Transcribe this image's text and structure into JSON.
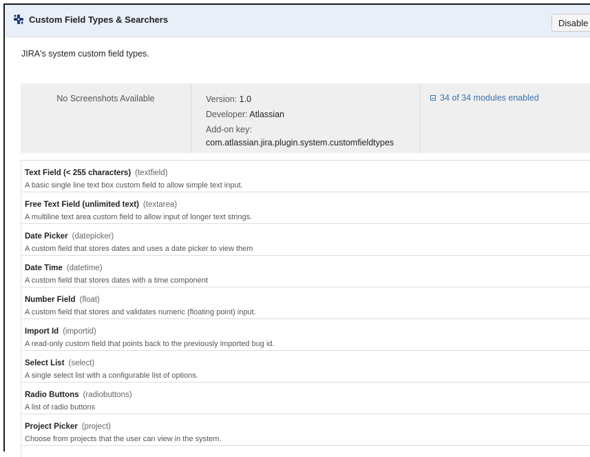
{
  "header": {
    "title": "Custom Field Types & Searchers",
    "disable_label": "Disable",
    "icon": "plugin-puzzle-icon"
  },
  "description": "JIRA's system custom field types.",
  "info": {
    "screenshots_text": "No Screenshots Available",
    "version_label": "Version:",
    "version_value": "1.0",
    "developer_label": "Developer:",
    "developer_value": "Atlassian",
    "addon_key_label": "Add-on key:",
    "addon_key_value": "com.atlassian.jira.plugin.system.customfieldtypes",
    "modules_link": "34 of 34 modules enabled"
  },
  "modules": [
    {
      "name": "Text Field (< 255 characters)",
      "key": "(textfield)",
      "desc": "A basic single line text box custom field to allow simple text input."
    },
    {
      "name": "Free Text Field (unlimited text)",
      "key": "(textarea)",
      "desc": "A multiline text area custom field to allow input of longer text strings."
    },
    {
      "name": "Date Picker",
      "key": "(datepicker)",
      "desc": "A custom field that stores dates and uses a date picker to view them"
    },
    {
      "name": "Date Time",
      "key": "(datetime)",
      "desc": "A custom field that stores dates with a time component"
    },
    {
      "name": "Number Field",
      "key": "(float)",
      "desc": "A custom field that stores and validates numeric (floating point) input."
    },
    {
      "name": "Import Id",
      "key": "(importid)",
      "desc": "A read-only custom field that points back to the previously imported bug id."
    },
    {
      "name": "Select List",
      "key": "(select)",
      "desc": "A single select list with a configurable list of options."
    },
    {
      "name": "Radio Buttons",
      "key": "(radiobuttons)",
      "desc": "A list of radio buttons"
    },
    {
      "name": "Project Picker",
      "key": "(project)",
      "desc": "Choose from projects that the user can view in the system."
    }
  ],
  "colors": {
    "header_bg": "#e9eff8",
    "link": "#3b73af",
    "info_bg": "#efefef"
  }
}
